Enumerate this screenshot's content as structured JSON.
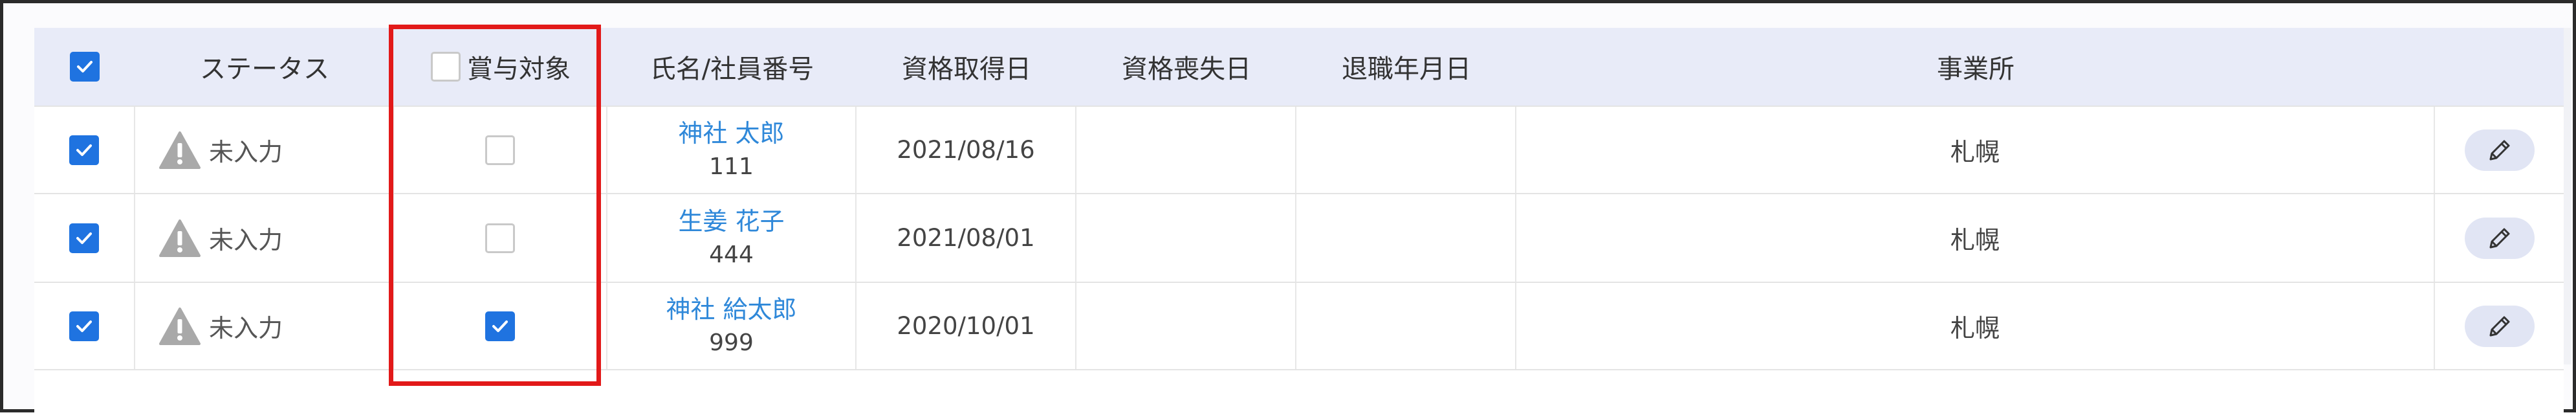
{
  "header": {
    "status": "ステータス",
    "bonus_target": "賞与対象",
    "name_id": "氏名/社員番号",
    "acquired_date": "資格取得日",
    "lost_date": "資格喪失日",
    "retire_date": "退職年月日",
    "office": "事業所"
  },
  "rows": [
    {
      "status": "未入力",
      "bonus_checked": false,
      "name": "神社 太郎",
      "emp_no": "111",
      "acquired": "2021/08/16",
      "lost": "",
      "retire": "",
      "office": "札幌"
    },
    {
      "status": "未入力",
      "bonus_checked": false,
      "name": "生姜 花子",
      "emp_no": "444",
      "acquired": "2021/08/01",
      "lost": "",
      "retire": "",
      "office": "札幌"
    },
    {
      "status": "未入力",
      "bonus_checked": true,
      "name": "神社 給太郎",
      "emp_no": "999",
      "acquired": "2020/10/01",
      "lost": "",
      "retire": "",
      "office": "札幌"
    }
  ],
  "colors": {
    "accent": "#1f73e0",
    "link": "#2f88d9",
    "highlight": "#e21919",
    "header_bg": "#e8ebf8"
  },
  "icons": [
    "check-icon",
    "warning-icon",
    "pencil-icon"
  ]
}
